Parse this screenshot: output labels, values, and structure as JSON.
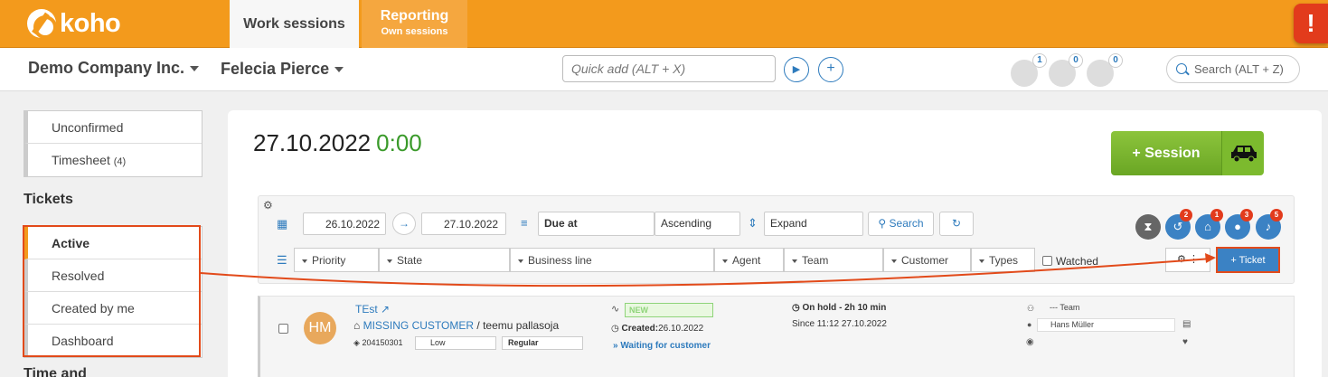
{
  "app": {
    "logo_text": "koho"
  },
  "topnav": {
    "tab_work": "Work sessions",
    "tab_reporting": "Reporting",
    "tab_reporting_sub": "Own sessions",
    "alert_symbol": "!"
  },
  "header": {
    "company": "Demo Company Inc.",
    "user": "Felecia Pierce",
    "quick_add_placeholder": "Quick add (ALT + X)",
    "play_symbol": "▶",
    "add_symbol": "+",
    "counters": [
      {
        "icon": "tickets-icon",
        "count": "1"
      },
      {
        "icon": "groups-icon",
        "count": "0"
      },
      {
        "icon": "messages-icon",
        "count": "0"
      }
    ],
    "search_placeholder": "Search (ALT + Z)"
  },
  "sidebar": {
    "top_items": [
      {
        "label": "Unconfirmed",
        "count": ""
      },
      {
        "label": "Timesheet",
        "count": "(4)"
      }
    ],
    "tickets_heading": "Tickets",
    "ticket_items": [
      {
        "label": "Active"
      },
      {
        "label": "Resolved"
      },
      {
        "label": "Created by me"
      },
      {
        "label": "Dashboard"
      }
    ],
    "next_heading": "Time and"
  },
  "main": {
    "date": "27.10.2022",
    "duration": "0:00",
    "session_button": "+ Session"
  },
  "filters": {
    "date_from": "26.10.2022",
    "date_to": "27.10.2022",
    "sort_field": "Due at",
    "sort_order": "Ascending",
    "expand": "Expand",
    "search_button": "Search",
    "dropdowns": [
      "Priority",
      "State",
      "Business line",
      "Agent",
      "Team",
      "Customer",
      "Types"
    ],
    "watched_label": "Watched",
    "ticket_button": "+ Ticket",
    "settings_more": "⋮",
    "status_badges": [
      "2",
      "1",
      "3",
      "5"
    ]
  },
  "ticket": {
    "title": "TEst",
    "customer": "MISSING CUSTOMER",
    "separator": "/",
    "contact": "teemu pallasoja",
    "id": "204150301",
    "priority": "Low",
    "type": "Regular",
    "status": "NEW",
    "created_label": "Created:",
    "created_date": "26.10.2022",
    "waiting": "Waiting for customer",
    "hold": "On hold - 2h 10 min",
    "since": "Since 11:12 27.10.2022",
    "avatar_initials": "HM",
    "team": "--- Team",
    "agent": "Hans Müller"
  },
  "colors": {
    "brand_orange": "#f39a1c",
    "accent_blue": "#2e7bbd",
    "green": "#7cba2e",
    "alert_red": "#e23b1c",
    "annotation_red": "#e24a1a"
  }
}
